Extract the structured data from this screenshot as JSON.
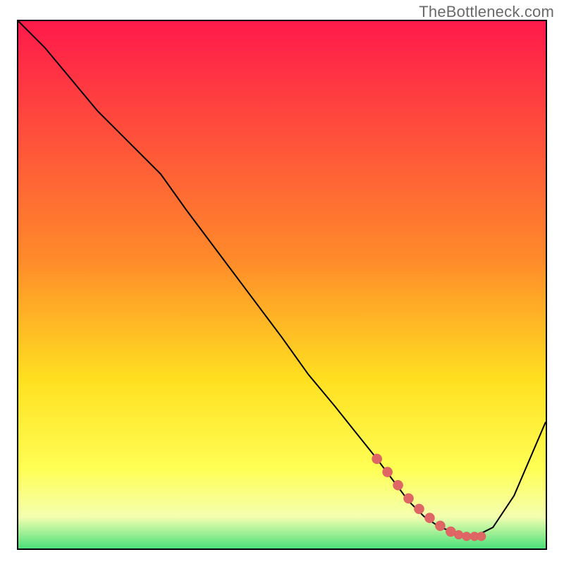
{
  "watermark": "TheBottleneck.com",
  "colors": {
    "border": "#000000",
    "curve": "#000000",
    "marker_fill": "#e06666",
    "marker_stroke": "#d35454",
    "grad_top": "#ff1a4b",
    "grad_mid1": "#ff8a2a",
    "grad_mid2": "#ffe020",
    "grad_mid3": "#ffff55",
    "grad_mid4": "#f4ffb0",
    "grad_bottom": "#4be07a"
  },
  "chart_data": {
    "type": "line",
    "title": "",
    "xlabel": "",
    "ylabel": "",
    "xlim": [
      0,
      100
    ],
    "ylim": [
      0,
      100
    ],
    "series": [
      {
        "name": "bottleneck-curve",
        "x": [
          0,
          5,
          10,
          15,
          20,
          23,
          27,
          32,
          38,
          44,
          50,
          55,
          60,
          64,
          68,
          71,
          74,
          77,
          80,
          83,
          86,
          90,
          94,
          97,
          100
        ],
        "y": [
          100,
          95,
          89,
          83,
          78,
          75,
          71,
          64,
          56,
          48,
          40,
          33,
          27,
          22,
          17,
          13,
          9,
          6,
          4,
          3,
          2,
          4,
          10,
          17,
          24
        ]
      }
    ],
    "highlight_segment": {
      "name": "rising-salmon-dots",
      "x": [
        68,
        70,
        72,
        74,
        76,
        78,
        80,
        82,
        83.5,
        85,
        86.5,
        87.8
      ],
      "y": [
        17,
        14.5,
        12,
        9.5,
        7.5,
        5.8,
        4.3,
        3.2,
        2.6,
        2.3,
        2.3,
        2.3
      ]
    },
    "background_gradient_stops": [
      {
        "offset": 0.0,
        "key": "grad_top"
      },
      {
        "offset": 0.45,
        "key": "grad_mid1"
      },
      {
        "offset": 0.68,
        "key": "grad_mid2"
      },
      {
        "offset": 0.85,
        "key": "grad_mid3"
      },
      {
        "offset": 0.94,
        "key": "grad_mid4"
      },
      {
        "offset": 1.0,
        "key": "grad_bottom"
      }
    ]
  }
}
